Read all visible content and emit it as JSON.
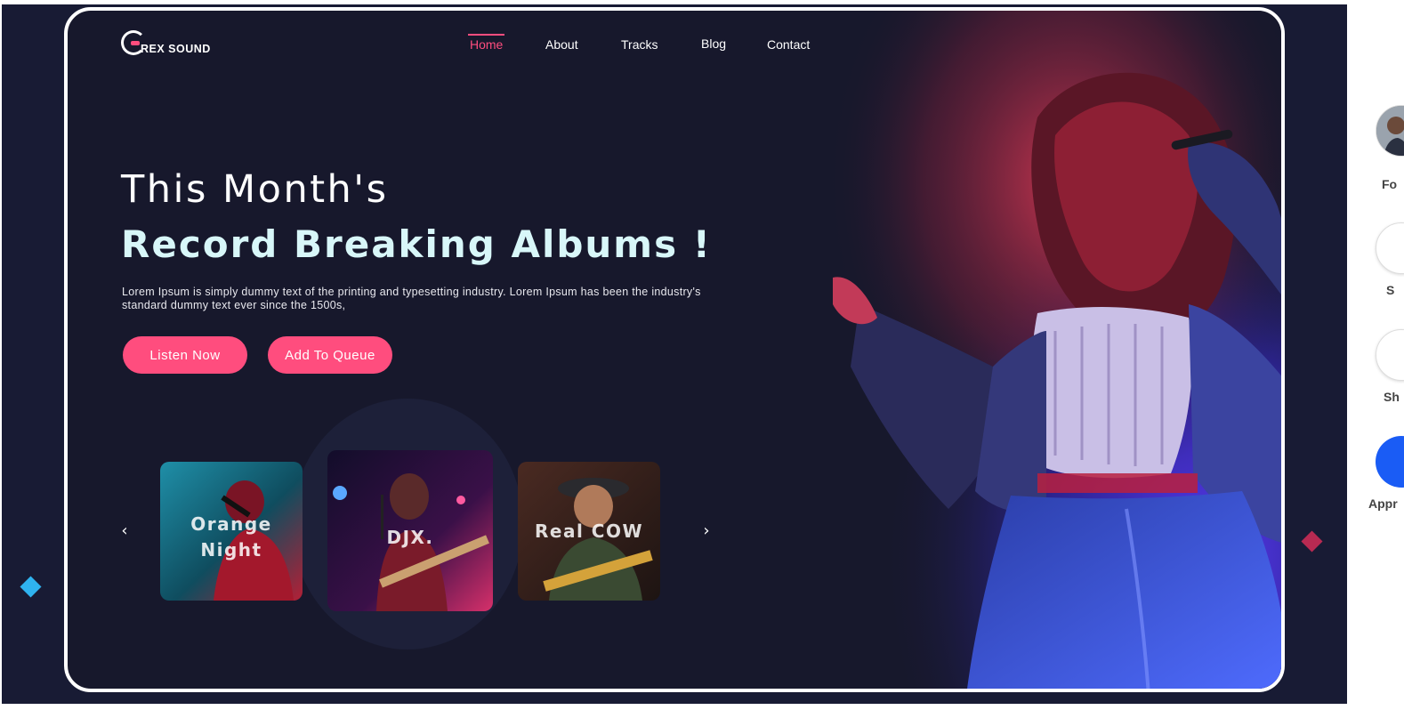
{
  "logo": {
    "text": "REX SOUND"
  },
  "nav": {
    "items": [
      {
        "label": "Home",
        "active": true
      },
      {
        "label": "About",
        "active": false
      },
      {
        "label": "Tracks",
        "active": false
      },
      {
        "label": "Blog",
        "active": false
      },
      {
        "label": "Contact",
        "active": false
      }
    ]
  },
  "hero": {
    "headline_line1": "This Month's",
    "headline_line2": "Record Breaking Albums !",
    "intro": "Lorem Ipsum is simply dummy text of the printing and typesetting industry. Lorem Ipsum has been the industry's standard dummy text ever since the 1500s,",
    "listen_button": "Listen Now",
    "queue_button": "Add To Queue"
  },
  "carousel": {
    "prev_icon": "chevron-left-icon",
    "next_icon": "chevron-right-icon",
    "albums": [
      {
        "title_line1": "Orange",
        "title_line2": "Night"
      },
      {
        "title_line1": "DJX.",
        "title_line2": ""
      },
      {
        "title_line1": "Real COW",
        "title_line2": ""
      }
    ]
  },
  "side_panel": {
    "labels": [
      "Fo",
      "S",
      "Sh",
      "Appr"
    ]
  },
  "colors": {
    "accent": "#ff4d7e",
    "background": "#17182c",
    "headline_highlight": "#d8f7f9",
    "diamond_blue": "#2fb3ef",
    "diamond_red": "#b82a52",
    "panel_button_blue": "#1a5cf5"
  }
}
